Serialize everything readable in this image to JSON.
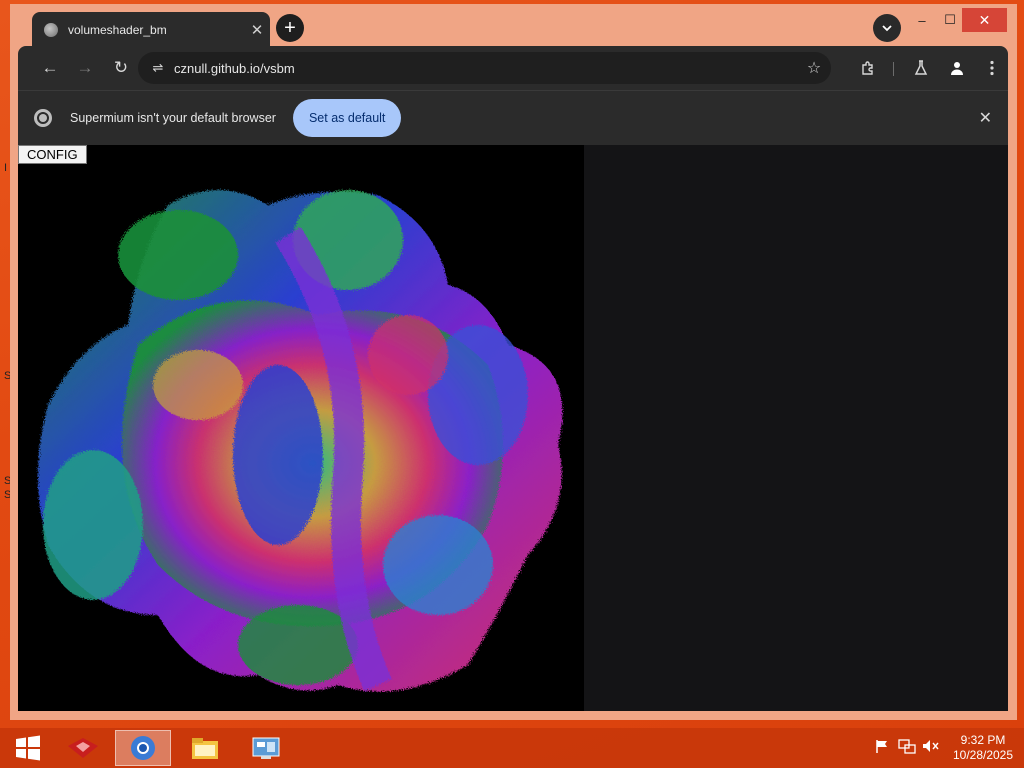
{
  "desktop": {
    "edge_letters": [
      "I",
      "S",
      "S",
      "S"
    ]
  },
  "browser": {
    "tab": {
      "title": "volumeshader_bm",
      "close_glyph": "✕"
    },
    "new_tab_glyph": "+",
    "tab_search_glyph": "⌄",
    "window_controls": {
      "minimize": "–",
      "maximize": "☐",
      "close": "✕"
    },
    "nav": {
      "back": "←",
      "forward": "→",
      "reload": "↻"
    },
    "omnibox": {
      "site_info_glyph": "⇌",
      "url": "cznull.github.io/vsbm",
      "star_glyph": "☆"
    },
    "toolbar_icons": [
      "extensions-icon",
      "labs-icon",
      "profile-icon",
      "menu-icon"
    ],
    "infobar": {
      "message": "Supermium isn't your default browser",
      "button_label": "Set as default",
      "close_glyph": "✕"
    }
  },
  "page": {
    "config_button": "CONFIG",
    "render": {
      "description_colors": [
        "#1a8f3a",
        "#2a3fd0",
        "#8a1fc9",
        "#d0306a",
        "#c9a23a",
        "#2fc17a"
      ]
    }
  },
  "taskbar": {
    "apps": [
      "start-icon",
      "app-red-icon",
      "browser-icon",
      "file-explorer-icon",
      "control-panel-icon"
    ],
    "clock": {
      "time": "9:32 PM",
      "date": "10/28/2025"
    }
  }
}
